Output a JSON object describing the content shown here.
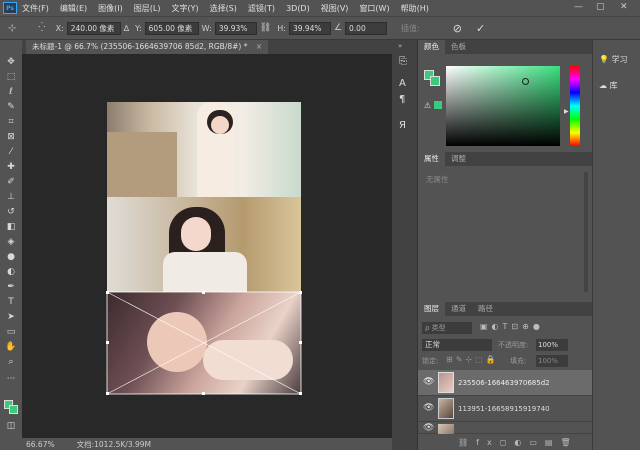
{
  "menubar": {
    "items": [
      "文件(F)",
      "编辑(E)",
      "图像(I)",
      "图层(L)",
      "文字(Y)",
      "选择(S)",
      "滤镜(T)",
      "3D(D)",
      "视图(V)",
      "窗口(W)",
      "帮助(H)"
    ],
    "logo": "Ps"
  },
  "options": {
    "x_label": "X:",
    "x_value": "240.00 像素",
    "y_label": "Y:",
    "y_value": "605.00 像素",
    "w_label": "W:",
    "w_value": "39.93%",
    "h_label": "H:",
    "h_value": "39.94%",
    "angle_label": "∆",
    "angle_value": "0.00",
    "interp_label": "插值:",
    "cancel_icon": "⃠",
    "commit_icon": "✓"
  },
  "document": {
    "tab_title": "未标题-1 @ 66.7% (235506-1664639706 85d2, RGB/8#) *",
    "tab_close": "×",
    "expand": "»"
  },
  "status": {
    "zoom": "66.67%",
    "doc_info": "文档:1012.5K/3.99M"
  },
  "color_panel": {
    "tabs": [
      "颜色",
      "色板"
    ],
    "fg_color": "#3ec97c",
    "bg_color": "#3ec97c"
  },
  "properties_panel": {
    "tabs": [
      "属性",
      "调整"
    ],
    "empty_text": "无属性"
  },
  "layers_panel": {
    "tabs": [
      "图层",
      "通道",
      "路径"
    ],
    "filter_label": "ρ 类型",
    "blend_mode": "正常",
    "opacity_label": "不透明度:",
    "opacity_value": "100%",
    "lock_label": "锁定:",
    "fill_label": "填充:",
    "fill_value": "100%",
    "layers": [
      {
        "name": "235506-166463970685d2",
        "selected": true
      },
      {
        "name": "113951-16658915919740",
        "selected": false
      },
      {
        "name": "",
        "selected": false
      }
    ]
  },
  "right_dock": {
    "learn": "学习",
    "library": "库"
  }
}
